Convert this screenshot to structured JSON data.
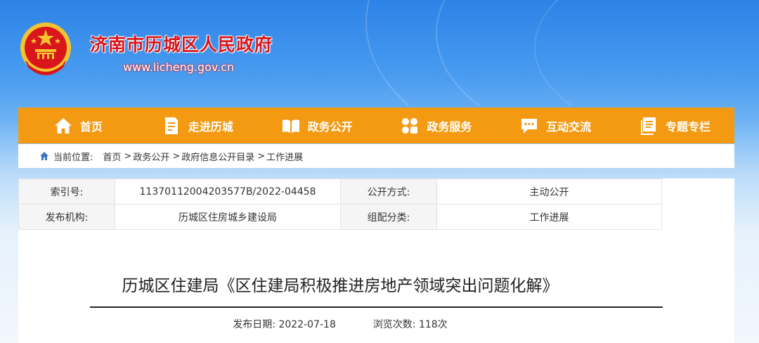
{
  "header": {
    "site_title": "济南市历城区人民政府",
    "site_url": "www.licheng.gov.cn"
  },
  "nav": {
    "items": [
      {
        "label": "首页",
        "icon": "home-icon"
      },
      {
        "label": "走进历城",
        "icon": "document-pen-icon"
      },
      {
        "label": "政务公开",
        "icon": "open-book-icon"
      },
      {
        "label": "政务服务",
        "icon": "service-grid-icon"
      },
      {
        "label": "互动交流",
        "icon": "chat-bubble-icon"
      },
      {
        "label": "专题专栏",
        "icon": "topic-list-icon"
      }
    ]
  },
  "breadcrumb": {
    "label": "当前位置:",
    "items": [
      "首页",
      "政务公开",
      "政府信息公开目录",
      "工作进展"
    ],
    "sep": ">"
  },
  "meta": {
    "index_label": "索引号:",
    "index_value": "11370112004203577B/2022-04458",
    "mode_label": "公开方式:",
    "mode_value": "主动公开",
    "publisher_label": "发布机构:",
    "publisher_value": "历城区住房城乡建设局",
    "category_label": "组配分类:",
    "category_value": "工作进展"
  },
  "article": {
    "title": "历城区住建局《区住建局积极推进房地产领域突出问题化解》",
    "date_label": "发布日期:",
    "date_value": "2022-07-18",
    "views_label": "浏览次数:",
    "views_value": "118次"
  },
  "colors": {
    "nav_bg": "#f39a12",
    "title_red": "#d8161b",
    "sky_blue": "#2d83e6"
  }
}
